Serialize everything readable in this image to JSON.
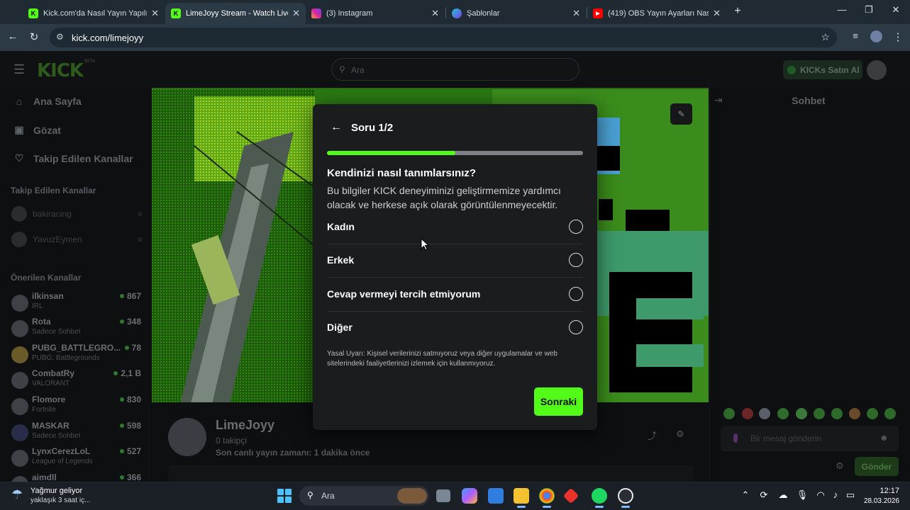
{
  "browser": {
    "tabs": [
      {
        "title": "Kick.com'da Nasıl Yayın Yapılır |",
        "icon": "kick-icon",
        "active": false
      },
      {
        "title": "LimeJoyy Stream - Watch Live o",
        "icon": "kick-icon",
        "active": true
      },
      {
        "title": "(3) Instagram",
        "icon": "instagram-icon",
        "active": false
      },
      {
        "title": "Şablonlar",
        "icon": "canva-icon",
        "active": false
      },
      {
        "title": "(419) OBS Yayın Ayarları Nasıl Y",
        "icon": "youtube-icon",
        "active": false
      }
    ],
    "url": "kick.com/limejoyy"
  },
  "site": {
    "logo": "KICK",
    "logo_badge": "BETA",
    "search_placeholder": "Ara",
    "kicks_button": "KICKs Satın Al"
  },
  "sidebar": {
    "nav": [
      {
        "label": "Ana Sayfa",
        "icon": "home-icon"
      },
      {
        "label": "Gözat",
        "icon": "browse-icon"
      },
      {
        "label": "Takip Edilen Kanallar",
        "icon": "heart-icon"
      }
    ],
    "followed_heading": "Takip Edilen Kanallar",
    "followed": [
      {
        "name": "bakiracing"
      },
      {
        "name": "YavuzEymen"
      }
    ],
    "recommended_heading": "Önerilen Kanallar",
    "recommended": [
      {
        "name": "ilkinsan",
        "category": "IRL",
        "viewers": "867"
      },
      {
        "name": "Rota",
        "category": "Sadece Sohbet",
        "viewers": "348"
      },
      {
        "name": "PUBG_BATTLEGRO...",
        "category": "PUBG: Battlegrounds",
        "viewers": "78"
      },
      {
        "name": "CombatRy",
        "category": "VALORANT",
        "viewers": "2,1 B"
      },
      {
        "name": "Flomore",
        "category": "Fortnite",
        "viewers": "830"
      },
      {
        "name": "MASKAR",
        "category": "Sadece Sohbet",
        "viewers": "598"
      },
      {
        "name": "LynxCerezLoL",
        "category": "League of Legends",
        "viewers": "527"
      },
      {
        "name": "aimdll",
        "category": "",
        "viewers": "366"
      }
    ]
  },
  "channel": {
    "name": "LimeJoyy",
    "followers": "0 takipçi",
    "last_stream": "Son canlı yayın zamanı: 1 dakika önce"
  },
  "chat": {
    "title": "Sohbet",
    "placeholder": "Bir mesaj gönderin",
    "send_label": "Gönder"
  },
  "modal": {
    "title": "Soru 1/2",
    "progress": 0.5,
    "question": "Kendinizi nasıl tanımlarsınız?",
    "description": "Bu bilgiler KICK deneyiminizi geliştirmemize yardımcı olacak ve herkese açık olarak görüntülenmeyecektir.",
    "options": [
      {
        "label": "Kadın"
      },
      {
        "label": "Erkek"
      },
      {
        "label": "Cevap vermeyi tercih etmiyorum"
      },
      {
        "label": "Diğer"
      }
    ],
    "legal": "Yasal Uyarı: Kişisel verilerinizi satmıyoruz veya diğer uygulamalar ve web sitelerindeki faaliyetlerinizi izlemek için kullanmıyoruz.",
    "next_label": "Sonraki"
  },
  "taskbar": {
    "weather_title": "Yağmur geliyor",
    "weather_sub": "yaklaşık 3 saat iç...",
    "search_placeholder": "Ara",
    "time": "12:17",
    "date": "28.03.2026"
  },
  "colors": {
    "accent": "#53fc18",
    "modal_bg": "#1a1c1e"
  }
}
